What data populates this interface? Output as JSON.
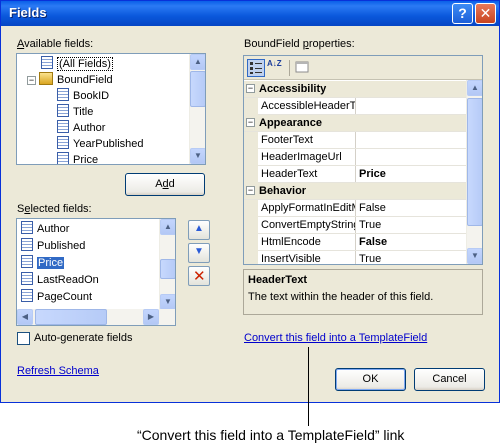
{
  "window": {
    "title": "Fields",
    "help_glyph": "?",
    "close_glyph": "✕"
  },
  "available": {
    "label_prefix": "A",
    "label_rest": "vailable fields:",
    "items": [
      {
        "label": "(All Fields)",
        "icon": "field-icon",
        "level": 1
      },
      {
        "label": "BoundField",
        "icon": "boundfield-icon",
        "level": 0,
        "expander": "−"
      },
      {
        "label": "BookID",
        "icon": "field-icon",
        "level": 2
      },
      {
        "label": "Title",
        "icon": "field-icon",
        "level": 2
      },
      {
        "label": "Author",
        "icon": "field-icon",
        "level": 2
      },
      {
        "label": "YearPublished",
        "icon": "field-icon",
        "level": 2
      },
      {
        "label": "Price",
        "icon": "field-icon",
        "level": 2
      }
    ]
  },
  "add_button": {
    "prefix": "A",
    "underlined": "d",
    "suffix": "d"
  },
  "selected": {
    "label_prefix": "S",
    "label_underlined": "e",
    "label_rest": "lected fields:",
    "items": [
      {
        "label": "Author"
      },
      {
        "label": "Published"
      },
      {
        "label": "Price",
        "selected": true
      },
      {
        "label": "LastReadOn"
      },
      {
        "label": "PageCount"
      }
    ]
  },
  "move_up_glyph": "▲",
  "move_down_glyph": "▼",
  "delete_glyph": "✕",
  "autogen": {
    "label": "Auto-generate fields",
    "underlined": "f",
    "checked": false
  },
  "refresh_link": "Refresh Schema",
  "properties": {
    "label_prefix": "BoundField ",
    "label_underlined": "p",
    "label_rest": "roperties:",
    "sort_az_glyph": "A↓Z",
    "rows": [
      {
        "type": "category",
        "name": "Accessibility",
        "expander": "−"
      },
      {
        "type": "prop",
        "name": "AccessibleHeaderTe",
        "value": "",
        "bold": false
      },
      {
        "type": "category",
        "name": "Appearance",
        "expander": "−"
      },
      {
        "type": "prop",
        "name": "FooterText",
        "value": "",
        "bold": false
      },
      {
        "type": "prop",
        "name": "HeaderImageUrl",
        "value": "",
        "bold": false
      },
      {
        "type": "prop",
        "name": "HeaderText",
        "value": "Price",
        "bold": true
      },
      {
        "type": "category",
        "name": "Behavior",
        "expander": "−"
      },
      {
        "type": "prop",
        "name": "ApplyFormatInEditM",
        "value": "False",
        "bold": false
      },
      {
        "type": "prop",
        "name": "ConvertEmptyString",
        "value": "True",
        "bold": false
      },
      {
        "type": "prop",
        "name": "HtmlEncode",
        "value": "False",
        "bold": true
      },
      {
        "type": "prop",
        "name": "InsertVisible",
        "value": "True",
        "bold": false
      }
    ],
    "description_title": "HeaderText",
    "description_text": "The text within the header of this field."
  },
  "convert_link": "Convert this field into a TemplateField",
  "ok_label": "OK",
  "cancel_label": "Cancel",
  "callout": "“Convert this field into a TemplateField” link",
  "colors": {
    "title_bar": "#0a58dc",
    "dialog_bg": "#ece9d8",
    "selection": "#316ac5",
    "link": "#0000cc",
    "delete_red": "#cc2200"
  }
}
